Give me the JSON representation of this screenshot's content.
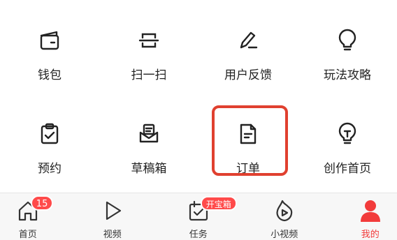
{
  "grid": {
    "items": [
      {
        "label": "钱包",
        "icon": "wallet-icon"
      },
      {
        "label": "扫一扫",
        "icon": "scan-icon"
      },
      {
        "label": "用户反馈",
        "icon": "feedback-pen-icon"
      },
      {
        "label": "玩法攻略",
        "icon": "lightbulb-icon"
      },
      {
        "label": "预约",
        "icon": "clipboard-check-icon"
      },
      {
        "label": "草稿箱",
        "icon": "draft-inbox-icon"
      },
      {
        "label": "订单",
        "icon": "order-document-icon"
      },
      {
        "label": "创作首页",
        "icon": "creator-bulb-icon"
      }
    ],
    "highlight_color": "#e0402f"
  },
  "tabbar": {
    "tabs": [
      {
        "label": "首页",
        "icon": "home-icon",
        "badge": "15"
      },
      {
        "label": "视频",
        "icon": "play-icon"
      },
      {
        "label": "任务",
        "icon": "task-icon",
        "badge": "开宝箱"
      },
      {
        "label": "小视频",
        "icon": "flame-play-icon"
      },
      {
        "label": "我的",
        "icon": "user-icon",
        "active": true
      }
    ],
    "active_color": "#f23b3b",
    "badge_color": "#ff4a4a"
  }
}
